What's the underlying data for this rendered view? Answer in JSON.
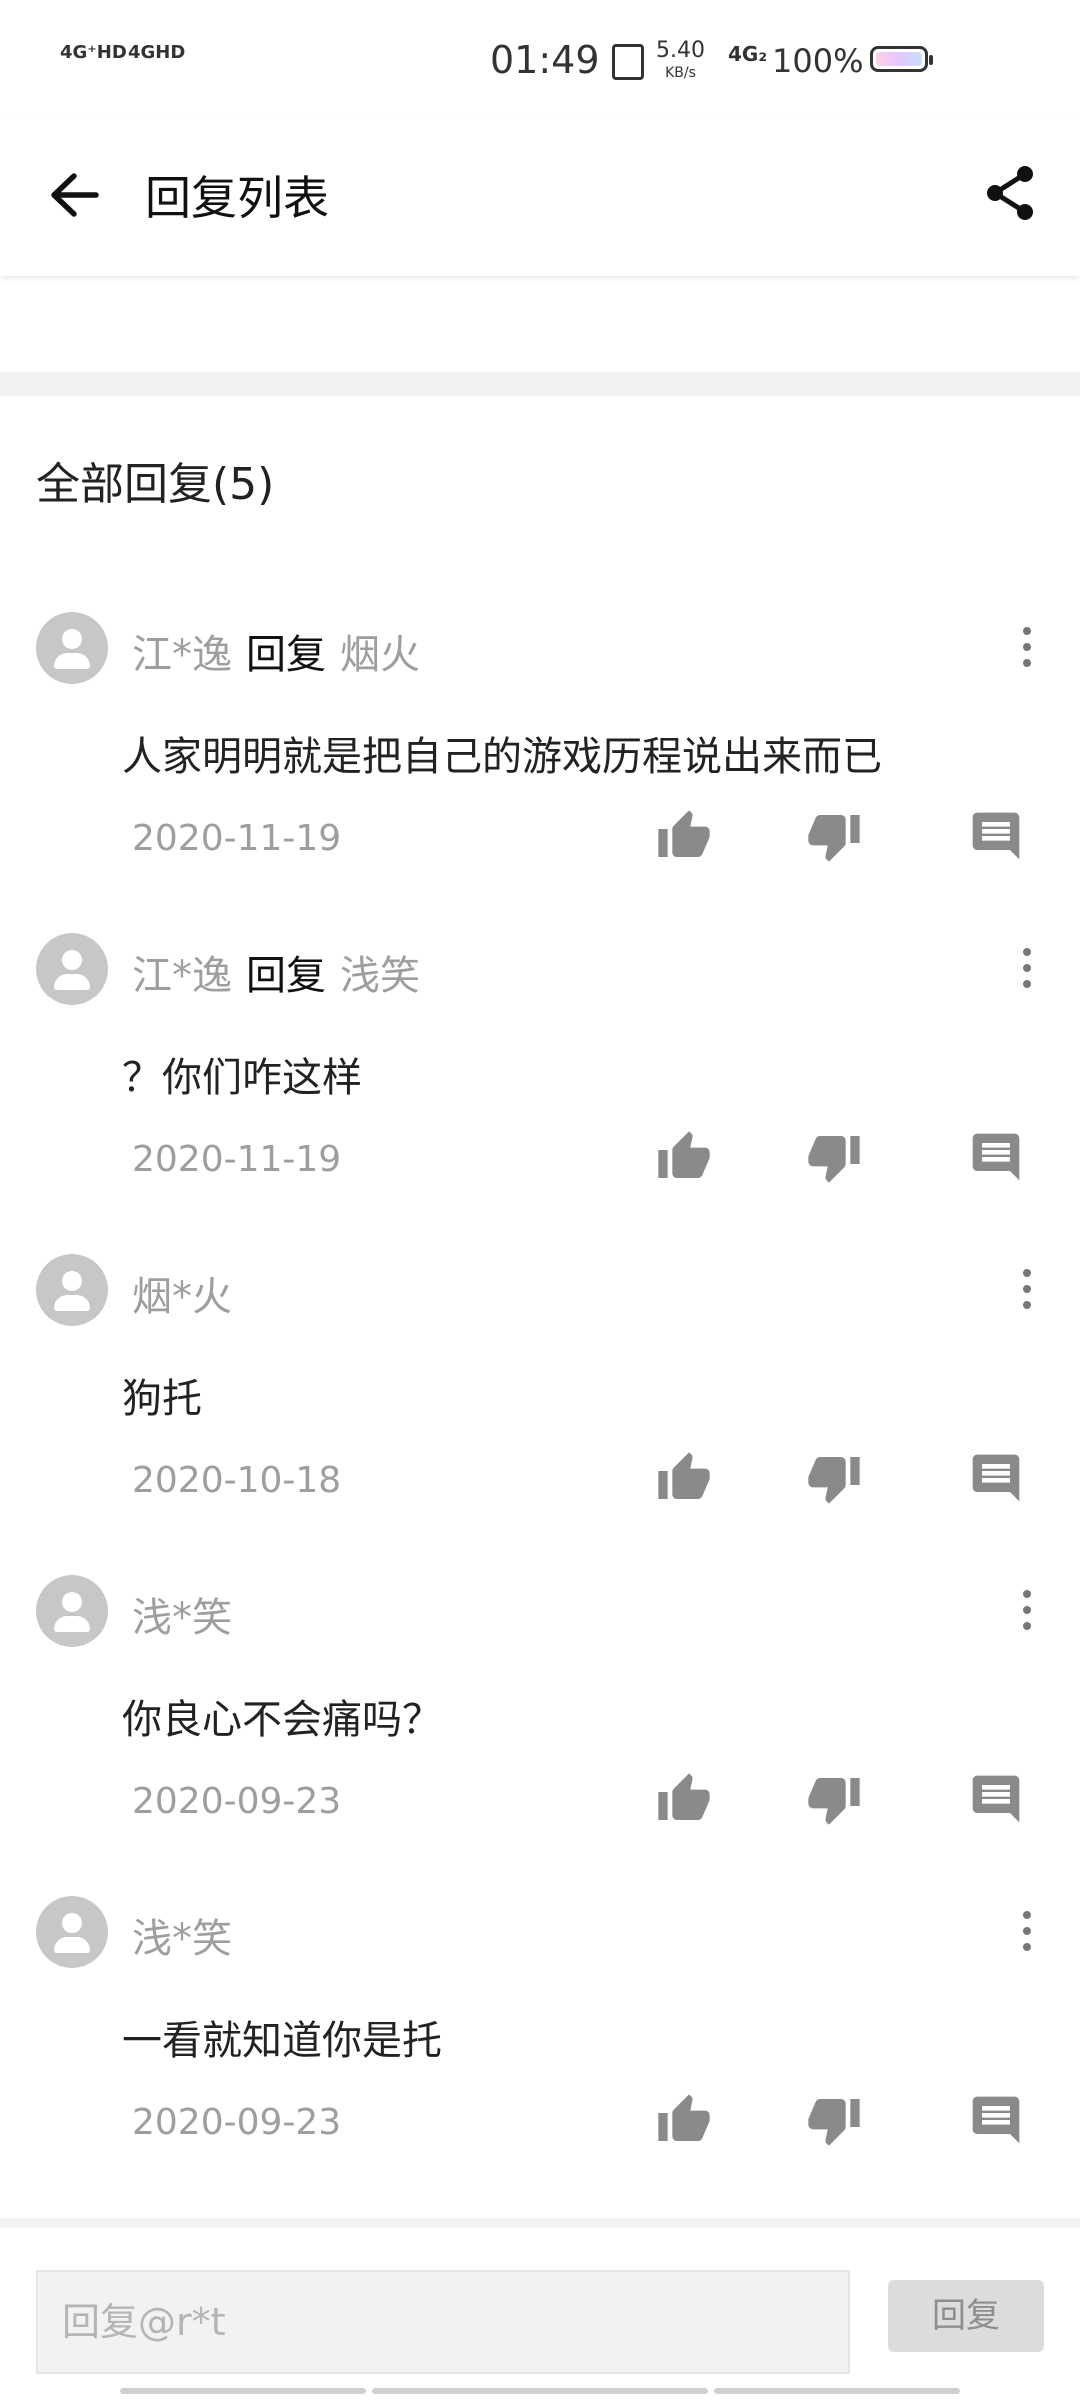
{
  "status_bar": {
    "signal_1": "4G⁺HD",
    "signal_2": "4GHD",
    "time": "01:49",
    "speed_value": "5.40",
    "speed_unit": "KB/s",
    "network": "4G₂",
    "battery": "100%"
  },
  "app_bar": {
    "title": "回复列表",
    "back_icon": "arrow-left-icon",
    "share_icon": "share-icon"
  },
  "section": {
    "title": "全部回复(5)"
  },
  "replies": [
    {
      "user": "江*逸",
      "verb": "回复",
      "target": "烟火",
      "text": "人家明明就是把自己的游戏历程说出来而已",
      "date": "2020-11-19"
    },
    {
      "user": "江*逸",
      "verb": "回复",
      "target": "浅笑",
      "text": "？你们咋这样",
      "date": "2020-11-19"
    },
    {
      "user": "烟*火",
      "verb": "",
      "target": "",
      "text": "狗托",
      "date": "2020-10-18"
    },
    {
      "user": "浅*笑",
      "verb": "",
      "target": "",
      "text": "你良心不会痛吗？",
      "date": "2020-09-23"
    },
    {
      "user": "浅*笑",
      "verb": "",
      "target": "",
      "text": "一看就知道你是托",
      "date": "2020-09-23"
    }
  ],
  "input": {
    "placeholder": "回复@r*t",
    "value": ""
  },
  "reply_button": {
    "label": "回复"
  },
  "colors": {
    "icon_gray": "#9e9e9e",
    "action_icon": "#8a8a8a",
    "divider": "#f2f2f2"
  }
}
